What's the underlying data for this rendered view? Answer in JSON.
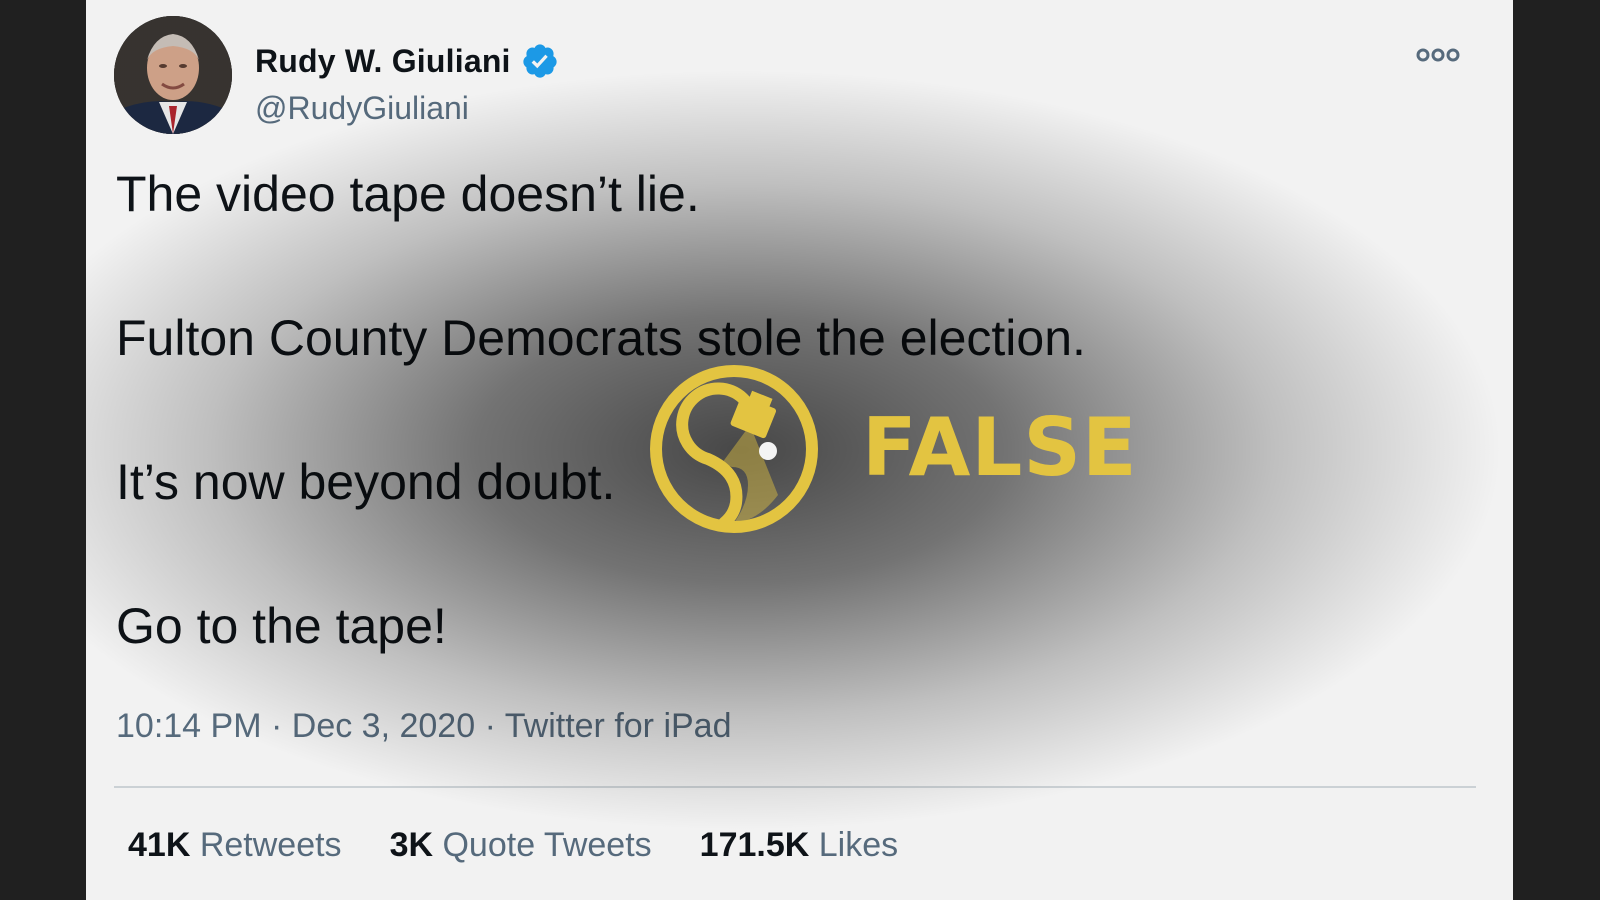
{
  "tweet": {
    "author": {
      "display_name": "Rudy W. Giuliani",
      "handle": "@RudyGiuliani",
      "verified": true,
      "avatar_icon": "profile-photo"
    },
    "more_icon": "more-options-icon",
    "body_lines": [
      "The video tape doesn’t lie.",
      "Fulton County Democrats stole the election.",
      "It’s now beyond doubt.",
      "Go to the tape!"
    ],
    "meta": {
      "time": "10:14 PM",
      "date": "Dec 3, 2020",
      "source": "Twitter for iPad",
      "separator": "·"
    },
    "stats": [
      {
        "count": "41K",
        "label": "Retweets"
      },
      {
        "count": "3K",
        "label": "Quote Tweets"
      },
      {
        "count": "171.5K",
        "label": "Likes"
      }
    ]
  },
  "rating": {
    "label": "FALSE",
    "color": "#e3c441",
    "logo_icon": "fact-check-logo-icon"
  },
  "colors": {
    "background": "#202020",
    "card": "#ffffff",
    "text_primary": "#0f1419",
    "text_secondary": "#5b7083",
    "verified_blue": "#1da1f2"
  }
}
